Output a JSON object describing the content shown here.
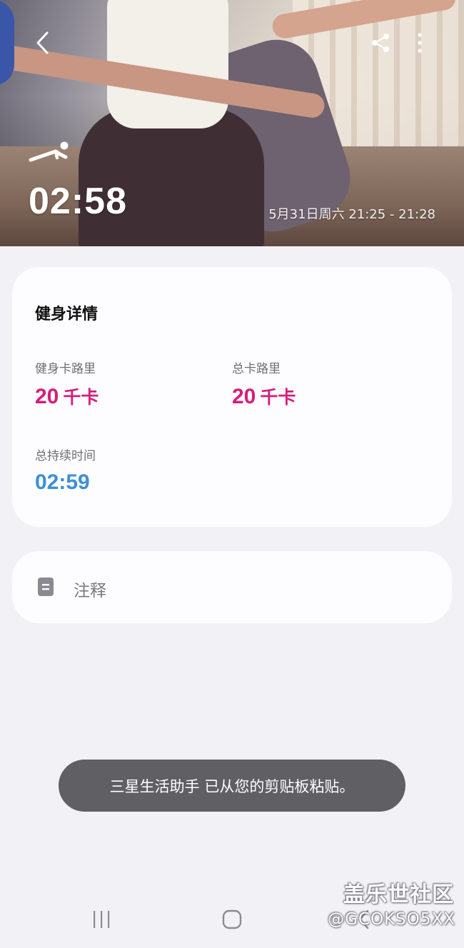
{
  "hero": {
    "duration": "02:58",
    "date_range": "5月31日周六 21:25 - 21:28"
  },
  "details": {
    "title": "健身详情",
    "stats": [
      {
        "label": "健身卡路里",
        "value": "20",
        "unit": "千卡",
        "color": "#d41f7a"
      },
      {
        "label": "总卡路里",
        "value": "20",
        "unit": "千卡",
        "color": "#d41f7a"
      },
      {
        "label": "总持续时间",
        "value": "02:59",
        "unit": "",
        "color": "#3d8fd8"
      }
    ]
  },
  "notes": {
    "label": "注释"
  },
  "toast": {
    "message": "三星生活助手 已从您的剪贴板粘贴。"
  },
  "watermark": {
    "title": "盖乐世社区",
    "handle": "@GCOKSO5XX"
  },
  "icons": {
    "back": "chevron-left-icon",
    "share": "share-icon",
    "more": "more-vertical-icon",
    "workout": "plank-workout-icon",
    "note": "note-icon"
  }
}
